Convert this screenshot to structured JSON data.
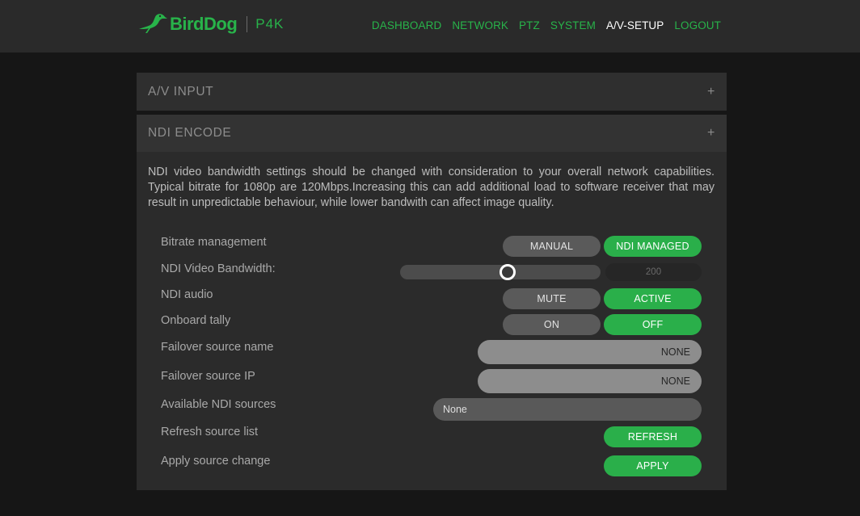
{
  "header": {
    "brand_name": "BirdDog",
    "model": "P4K",
    "nav": [
      {
        "label": "DASHBOARD",
        "active": false
      },
      {
        "label": "NETWORK",
        "active": false
      },
      {
        "label": "PTZ",
        "active": false
      },
      {
        "label": "SYSTEM",
        "active": false
      },
      {
        "label": "A/V-SETUP",
        "active": true
      },
      {
        "label": "LOGOUT",
        "active": false
      }
    ]
  },
  "av_input": {
    "title": "A/V INPUT",
    "toggle": "+"
  },
  "ndi_encode": {
    "title": "NDI ENCODE",
    "toggle": "+",
    "description": "NDI video bandwidth settings should be changed with consideration to your overall network capabilities. Typical bitrate for 1080p are 120Mbps.Increasing this can add additional load to software receiver that may result in unpredictable behaviour, while lower bandwith can affect image quality.",
    "bitrate": {
      "label": "Bitrate management",
      "options": [
        "MANUAL",
        "NDI MANAGED"
      ],
      "selected": "NDI MANAGED"
    },
    "bandwidth": {
      "label": "NDI Video Bandwidth:",
      "value": "200",
      "slider_fraction": 0.47
    },
    "audio": {
      "label": "NDI audio",
      "options": [
        "MUTE",
        "ACTIVE"
      ],
      "selected": "ACTIVE"
    },
    "tally": {
      "label": "Onboard tally",
      "options": [
        "ON",
        "OFF"
      ],
      "selected": "OFF"
    },
    "failover_name": {
      "label": "Failover source name",
      "value": "NONE"
    },
    "failover_ip": {
      "label": "Failover source IP",
      "value": "NONE"
    },
    "available_sources": {
      "label": "Available NDI sources",
      "value": "None"
    },
    "refresh": {
      "label": "Refresh source list",
      "button": "REFRESH"
    },
    "apply": {
      "label": "Apply source change",
      "button": "APPLY"
    }
  },
  "colors": {
    "accent_green": "#2aaf4a",
    "background": "#161616",
    "panel": "#2f2f2f"
  }
}
